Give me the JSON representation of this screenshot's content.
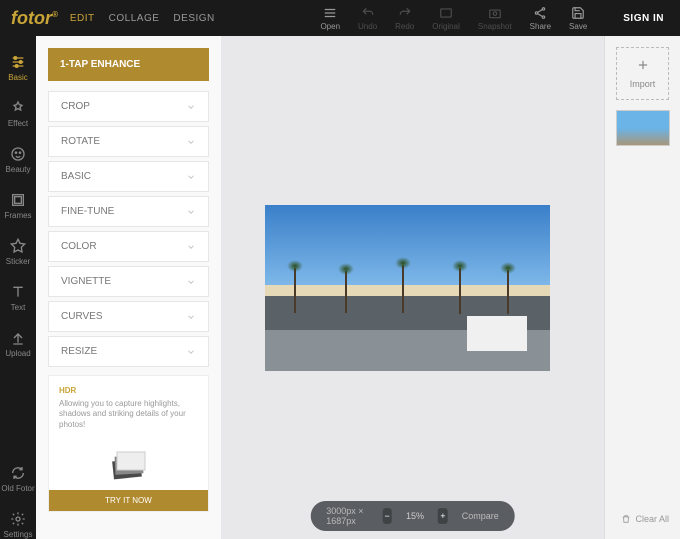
{
  "brand": "fotor",
  "topnav": {
    "edit": "EDIT",
    "collage": "COLLAGE",
    "design": "DESIGN"
  },
  "toptools": {
    "open": "Open",
    "undo": "Undo",
    "redo": "Redo",
    "original": "Original",
    "snapshot": "Snapshot",
    "share": "Share",
    "save": "Save"
  },
  "signin": "SIGN IN",
  "lefttools": {
    "basic": "Basic",
    "effect": "Effect",
    "beauty": "Beauty",
    "frames": "Frames",
    "sticker": "Sticker",
    "text": "Text",
    "upload": "Upload",
    "oldfotor": "Old Fotor",
    "settings": "Settings"
  },
  "panel": {
    "enhance": "1-TAP ENHANCE",
    "items": [
      "CROP",
      "ROTATE",
      "BASIC",
      "FINE-TUNE",
      "COLOR",
      "VIGNETTE",
      "CURVES",
      "RESIZE"
    ],
    "hdr": {
      "title": "HDR",
      "desc": "Allowing you to capture highlights, shadows and striking details of your photos!",
      "try": "TRY IT NOW"
    }
  },
  "right": {
    "import": "Import",
    "clear": "Clear All"
  },
  "bottom": {
    "dims": "3000px × 1687px",
    "zoom": "15%",
    "compare": "Compare"
  }
}
